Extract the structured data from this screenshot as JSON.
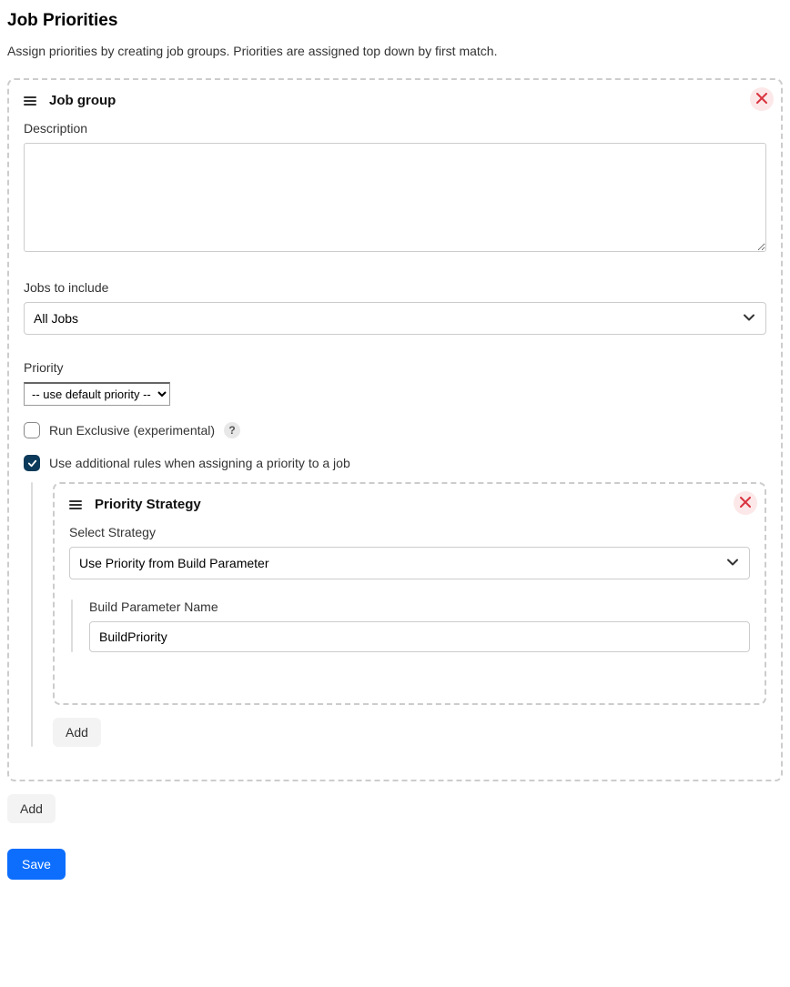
{
  "page": {
    "title": "Job Priorities",
    "intro": "Assign priorities by creating job groups. Priorities are assigned top down by first match."
  },
  "group": {
    "header": "Job group",
    "description_label": "Description",
    "description_value": "",
    "jobs_label": "Jobs to include",
    "jobs_selected": "All Jobs",
    "priority_label": "Priority",
    "priority_selected": "-- use default priority --",
    "run_exclusive_label": "Run Exclusive (experimental)",
    "help_symbol": "?",
    "additional_rules_label": "Use additional rules when assigning a priority to a job"
  },
  "strategy": {
    "header": "Priority Strategy",
    "select_label": "Select Strategy",
    "selected": "Use Priority from Build Parameter",
    "param_label": "Build Parameter Name",
    "param_value": "BuildPriority"
  },
  "buttons": {
    "add_inner": "Add",
    "add_outer": "Add",
    "save": "Save"
  }
}
